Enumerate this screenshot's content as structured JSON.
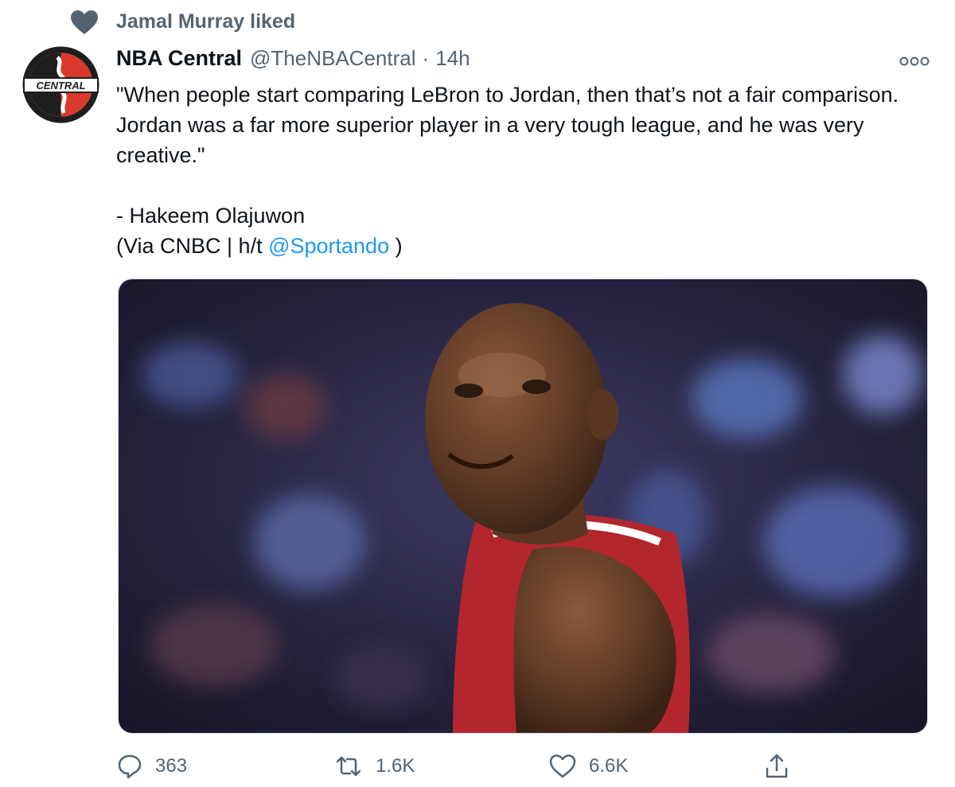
{
  "social_context": {
    "text": "Jamal Murray liked",
    "icon": "heart-icon"
  },
  "author": {
    "display_name": "NBA Central",
    "handle": "@TheNBACentral",
    "separator": "·",
    "time": "14h",
    "avatar_text": "CENTRAL"
  },
  "tweet": {
    "line1": "\"When people start comparing LeBron to Jordan, then that’s not a fair comparison. Jordan was a far more superior player in a very tough league, and he was very creative.\"",
    "attribution": "- Hakeem Olajuwon",
    "via_prefix": "(Via CNBC | h/t ",
    "via_mention": "@Sportando",
    "via_suffix": " )"
  },
  "actions": {
    "reply_count": "363",
    "retweet_count": "1.6K",
    "like_count": "6.6K"
  },
  "colors": {
    "link": "#1d9bf0",
    "muted": "#536471",
    "text": "#0f1419"
  }
}
